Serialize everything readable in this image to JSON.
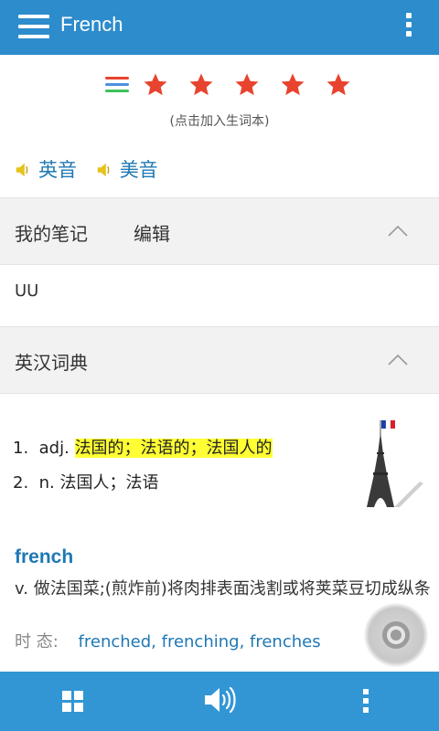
{
  "header": {
    "title": "French",
    "menu_icon": "menu-icon",
    "overflow_icon": "more-vert-icon"
  },
  "rating": {
    "stars": 5,
    "star_color": "#e8432e",
    "hint": "(点击加入生词本)"
  },
  "pronunciation": {
    "uk_label": "英音",
    "us_label": "美音"
  },
  "notes": {
    "title": "我的笔记",
    "edit_label": "编辑",
    "content": "UU"
  },
  "dictionary": {
    "title": "英汉词典",
    "definitions": [
      {
        "num": "1.",
        "pos": "adj.",
        "text": "法国的；法语的；法国人的",
        "highlighted": true
      },
      {
        "num": "2.",
        "pos": "n.",
        "text": "法国人；法语",
        "highlighted": false
      }
    ],
    "headword": "french",
    "verb_definition": "v. 做法国菜;(煎炸前)将肉排表面浅割或将荚菜豆切成纵条",
    "tense_label": "时 态:",
    "tense_forms": "frenched, frenching, frenches"
  },
  "bottom_bar": {
    "left_icon": "grid-icon",
    "center_icon": "speaker-icon",
    "right_icon": "more-vert-icon"
  },
  "colors": {
    "primary": "#2c8ccc",
    "link": "#1f78b4",
    "highlight": "#ffff33"
  }
}
